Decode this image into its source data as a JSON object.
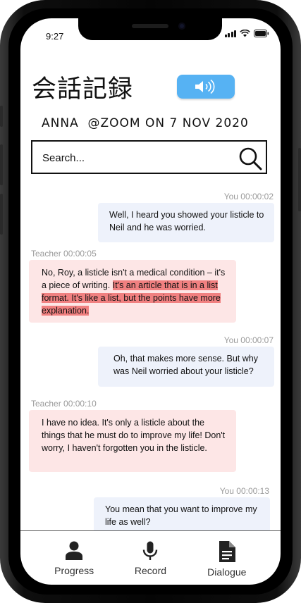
{
  "status_bar": {
    "time": "9:27"
  },
  "header": {
    "title": "会話記録",
    "meta": "ANNA  @ZOOM ON 7 NOV 2020",
    "sound_button_icon": "speaker-volume-icon"
  },
  "search": {
    "placeholder": "Search..."
  },
  "messages": [
    {
      "speaker": "you",
      "timestamp": "You 00:00:02",
      "text": "Well, I heard you showed your listicle to Neil and he was worried."
    },
    {
      "speaker": "teacher",
      "timestamp": "Teacher 00:00:05",
      "text_plain": "No, Roy, a listicle isn't a medical condition – it's a piece of writing. ",
      "text_highlight": "It's an article that is in a list format. It's like a list, but the points have more explanation."
    },
    {
      "speaker": "you",
      "timestamp": "You 00:00:07",
      "text": "Oh, that makes more sense. But why was Neil worried about your listicle?"
    },
    {
      "speaker": "teacher",
      "timestamp": "Teacher 00:00:10",
      "text": "I have no idea. It's only a listicle about the things that he must do to improve my life! Don't worry, I haven't forgotten you in the listicle."
    },
    {
      "speaker": "you",
      "timestamp": "You 00:00:13",
      "text": "You mean that you want to improve my life as well?"
    }
  ],
  "tabs": [
    {
      "label": "Progress",
      "icon": "person-icon"
    },
    {
      "label": "Record",
      "icon": "microphone-icon"
    },
    {
      "label": "Dialogue",
      "icon": "document-icon"
    }
  ],
  "colors": {
    "accent": "#56b2f3",
    "you_bubble": "#eef2fb",
    "teacher_bubble": "#fde6e6",
    "highlight": "#f08080"
  }
}
